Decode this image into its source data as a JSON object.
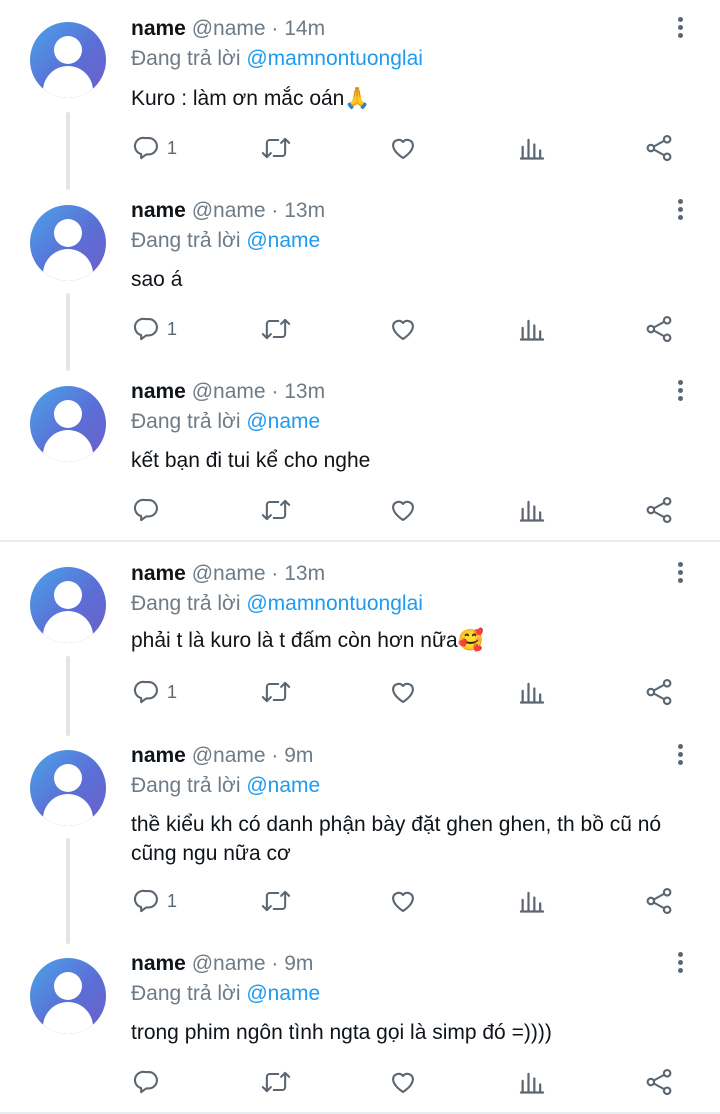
{
  "tweets": [
    {
      "name": "name",
      "handle": "@name",
      "time": "· 14m",
      "replying_prefix": "Đang trả lời",
      "replying_to": "@mamnontuonglai",
      "text": "Kuro : làm ơn mắc oán",
      "emoji": "🙏",
      "reply_count": "1"
    },
    {
      "name": "name",
      "handle": "@name",
      "time": "· 13m",
      "replying_prefix": "Đang trả lời",
      "replying_to": "@name",
      "text": "sao á",
      "emoji": "",
      "reply_count": "1"
    },
    {
      "name": "name",
      "handle": "@name",
      "time": "· 13m",
      "replying_prefix": "Đang trả lời",
      "replying_to": "@name",
      "text": "kết bạn đi tui kể cho nghe",
      "emoji": "",
      "reply_count": ""
    },
    {
      "name": "name",
      "handle": "@name",
      "time": "· 13m",
      "replying_prefix": "Đang trả lời",
      "replying_to": "@mamnontuonglai",
      "text": "phải t là kuro là t đấm còn hơn nữa",
      "emoji": "🥰",
      "reply_count": "1"
    },
    {
      "name": "name",
      "handle": "@name",
      "time": "· 9m",
      "replying_prefix": "Đang trả lời",
      "replying_to": "@name",
      "text": "thề kiểu kh có danh phận bày đặt ghen ghen, th bồ cũ nó cũng ngu nữa cơ",
      "emoji": "",
      "reply_count": "1"
    },
    {
      "name": "name",
      "handle": "@name",
      "time": "· 9m",
      "replying_prefix": "Đang trả lời",
      "replying_to": "@name",
      "text": "trong phim ngôn tình ngta gọi là simp đó =))))",
      "emoji": "",
      "reply_count": ""
    }
  ],
  "icons": {
    "reply": "reply-icon",
    "retweet": "retweet-icon",
    "like": "heart-icon",
    "views": "analytics-icon",
    "share": "share-icon",
    "more": "more-vertical-icon"
  },
  "colors": {
    "mention": "#1d9bf0",
    "secondary_text": "#6e7b86",
    "primary_text": "#0f1419",
    "icon": "#5b6670",
    "divider": "#e6ecf0"
  }
}
